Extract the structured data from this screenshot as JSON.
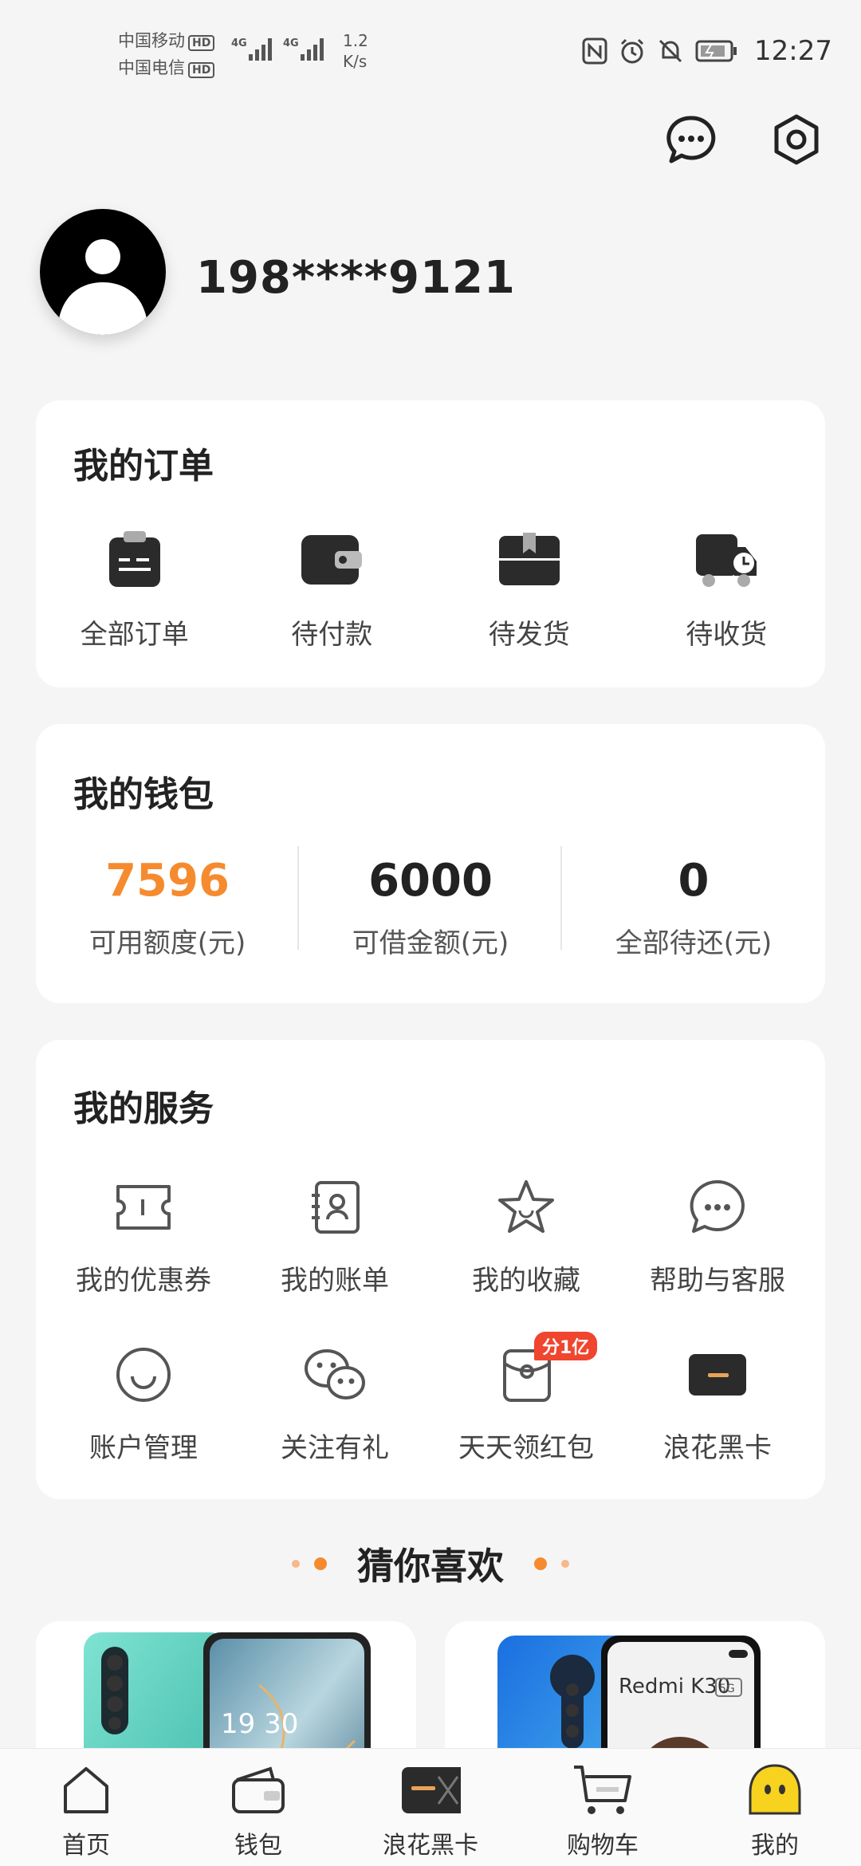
{
  "status_bar": {
    "carrier1": "中国移动",
    "carrier2": "中国电信",
    "hd_badge": "HD",
    "network": "4G",
    "speed_value": "1.2",
    "speed_unit": "K/s",
    "time": "12:27"
  },
  "header": {
    "icons": [
      "message-icon",
      "settings-icon"
    ]
  },
  "profile": {
    "username": "198****9121"
  },
  "orders": {
    "title": "我的订单",
    "items": [
      {
        "label": "全部订单",
        "icon": "clipboard-icon"
      },
      {
        "label": "待付款",
        "icon": "wallet-icon"
      },
      {
        "label": "待发货",
        "icon": "package-icon"
      },
      {
        "label": "待收货",
        "icon": "truck-icon"
      }
    ]
  },
  "wallet": {
    "title": "我的钱包",
    "items": [
      {
        "value": "7596",
        "label": "可用额度(元)",
        "color": "#f58b2e"
      },
      {
        "value": "6000",
        "label": "可借金额(元)"
      },
      {
        "value": "0",
        "label": "全部待还(元)"
      }
    ]
  },
  "services": {
    "title": "我的服务",
    "items": [
      {
        "label": "我的优惠券",
        "icon": "coupon-icon"
      },
      {
        "label": "我的账单",
        "icon": "bill-icon"
      },
      {
        "label": "我的收藏",
        "icon": "star-icon"
      },
      {
        "label": "帮助与客服",
        "icon": "chat-bubble-icon"
      },
      {
        "label": "账户管理",
        "icon": "smile-icon"
      },
      {
        "label": "关注有礼",
        "icon": "wechat-icon"
      },
      {
        "label": "天天领红包",
        "icon": "red-packet-icon",
        "badge": "分1亿"
      },
      {
        "label": "浪花黑卡",
        "icon": "black-card-icon"
      }
    ]
  },
  "recommend": {
    "title": "猜你喜欢",
    "products": [
      {
        "image": "phone-product-image",
        "screen_text": "19 30"
      },
      {
        "image": "redmi-product-image",
        "screen_text": "Redmi K30",
        "badge": "5G"
      }
    ]
  },
  "bottom_nav": [
    {
      "label": "首页",
      "icon": "home-icon"
    },
    {
      "label": "钱包",
      "icon": "wallet-nav-icon"
    },
    {
      "label": "浪花黑卡",
      "icon": "black-card-nav-icon"
    },
    {
      "label": "购物车",
      "icon": "cart-icon"
    },
    {
      "label": "我的",
      "icon": "profile-face-icon"
    }
  ],
  "colors": {
    "accent": "#f58b2e",
    "background": "#f5f5f5",
    "badge_red": "#f0452e"
  }
}
